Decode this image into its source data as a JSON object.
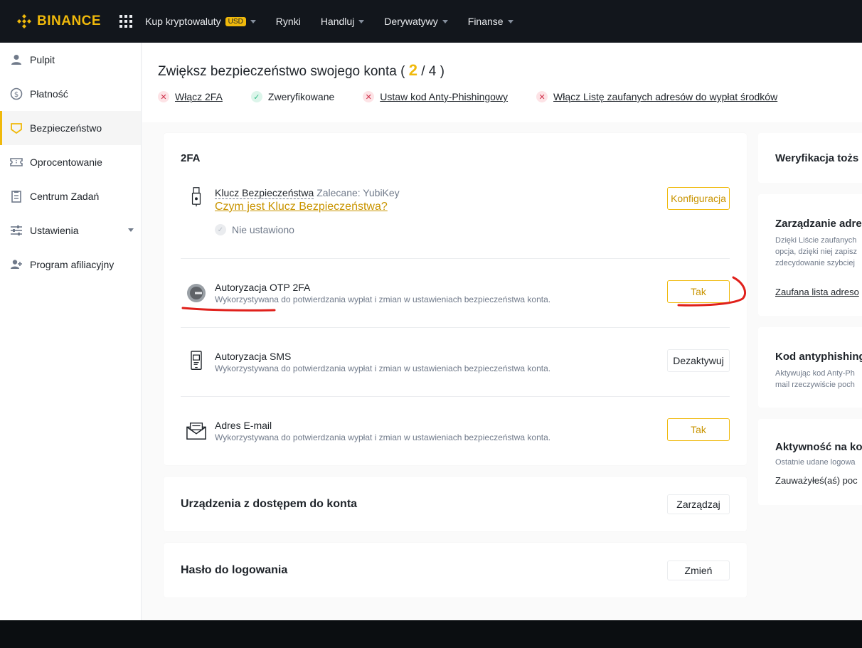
{
  "brand": {
    "name": "BINANCE",
    "color": "#f0b90b"
  },
  "nav": {
    "items": [
      {
        "label": "Kup kryptowaluty",
        "badge": "USD",
        "dropdown": true
      },
      {
        "label": "Rynki",
        "dropdown": false
      },
      {
        "label": "Handluj",
        "dropdown": true
      },
      {
        "label": "Derywatywy",
        "dropdown": true
      },
      {
        "label": "Finanse",
        "dropdown": true
      }
    ]
  },
  "sidebar": {
    "items": [
      {
        "label": "Pulpit",
        "icon": "user-icon"
      },
      {
        "label": "Płatność",
        "icon": "dollar-icon"
      },
      {
        "label": "Bezpieczeństwo",
        "icon": "shield-icon",
        "active": true
      },
      {
        "label": "Oprocentowanie",
        "icon": "ticket-icon"
      },
      {
        "label": "Centrum Zadań",
        "icon": "task-icon"
      },
      {
        "label": "Ustawienia",
        "icon": "sliders-icon",
        "dropdown": true
      },
      {
        "label": "Program afiliacyjny",
        "icon": "add-user-icon"
      }
    ]
  },
  "header": {
    "title": "Zwiększ bezpieczeństwo swojego konta (",
    "done": "2",
    "total": "/ 4 )",
    "checks": [
      {
        "label": "Włącz 2FA",
        "status": "bad"
      },
      {
        "label": "Zweryfikowane",
        "status": "good"
      },
      {
        "label": "Ustaw kod Anty-Phishingowy",
        "status": "bad"
      },
      {
        "label": "Włącz Listę zaufanych adresów do wypłat środków",
        "status": "bad"
      }
    ]
  },
  "twofa": {
    "title": "2FA",
    "rows": [
      {
        "title": "Klucz Bezpieczeństwa",
        "recommend": "Zalecane: YubiKey",
        "link": "Czym jest Klucz Bezpieczeństwa?",
        "status": "Nie ustawiono",
        "button": "Konfiguracja"
      },
      {
        "title": "Autoryzacja OTP 2FA",
        "desc": "Wykorzystywana do potwierdzania wypłat i zmian w ustawieniach bezpieczeństwa konta.",
        "button": "Tak"
      },
      {
        "title": "Autoryzacja SMS",
        "desc": "Wykorzystywana do potwierdzania wypłat i zmian w ustawieniach bezpieczeństwa konta.",
        "button": "Dezaktywuj"
      },
      {
        "title": "Adres E-mail",
        "desc": "Wykorzystywana do potwierdzania wypłat i zmian w ustawieniach bezpieczeństwa konta.",
        "button": "Tak"
      }
    ]
  },
  "devices": {
    "title": "Urządzenia z dostępem do konta",
    "button": "Zarządzaj"
  },
  "password": {
    "title": "Hasło do logowania",
    "button": "Zmień"
  },
  "right": {
    "identity": {
      "title": "Weryfikacja tożs"
    },
    "address": {
      "title": "Zarządzanie adre",
      "desc1": "Dzięki Liście zaufanych",
      "desc2": "opcja, dzięki niej zapisz",
      "desc3": "zdecydowanie szybciej",
      "link": "Zaufana lista adreso"
    },
    "antiphishing": {
      "title": "Kod antyphishing",
      "desc1": "Aktywując kod Anty-Ph",
      "desc2": "mail rzeczywiście poch"
    },
    "activity": {
      "title": "Aktywność na ko",
      "desc1": "Ostatnie udane logowa",
      "note": "Zauważyłeś(aś) poc"
    }
  }
}
